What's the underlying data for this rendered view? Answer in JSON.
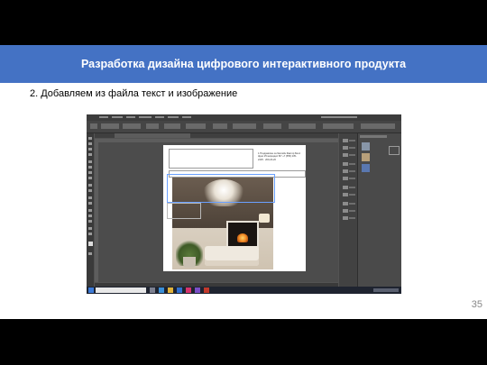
{
  "slide": {
    "title": "Разработка дизайна цифрового интерактивного продукта",
    "subtitle": "2. Добавляем из файла текст и изображение",
    "page_number": "35"
  },
  "screenshot": {
    "app": "Adobe InDesign",
    "document_text": "1.Поздравляю за бассейн Фактор Белл фрез 25 мираздил 8/7 +7 (555) 235-2225 · 200-20-20",
    "taskbar_search_placeholder": "Введите здесь текст для поиска",
    "colors": {
      "slide_header": "#4472c4",
      "app_background": "#535353",
      "taskbar": "#1f2430"
    }
  }
}
